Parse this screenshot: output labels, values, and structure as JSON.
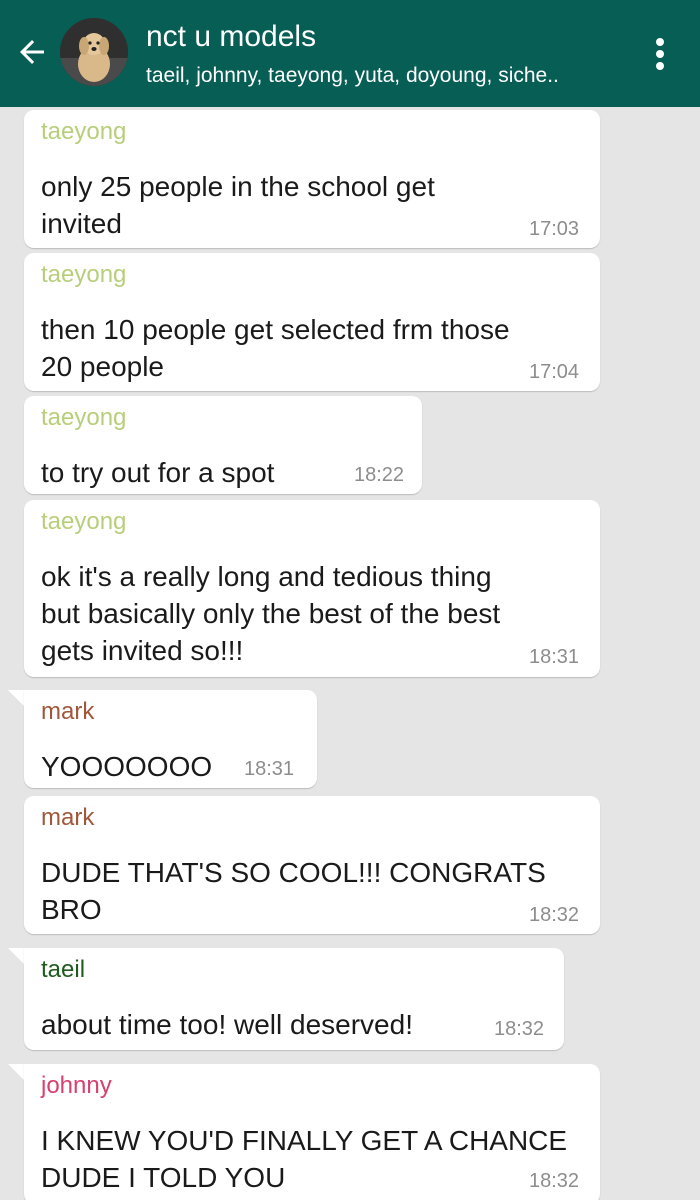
{
  "header": {
    "title": "nct u models",
    "subtitle": "taeil, johnny, taeyong, yuta, doyoung, siche..",
    "bg_color": "#075e54",
    "back_icon": "arrow-left-icon",
    "menu_icon": "more-vert-icon"
  },
  "colors": {
    "taeyong": "#b7cf7a",
    "mark": "#a0573a",
    "taeil": "#1f5a1f",
    "johnny": "#d8406e"
  },
  "messages": [
    {
      "sender": "taeyong",
      "line1": "only 25 people in the school get",
      "line2": "invited",
      "time": "17:03"
    },
    {
      "sender": "taeyong",
      "line1": "then 10 people get selected frm those",
      "line2": "20 people",
      "time": "17:04"
    },
    {
      "sender": "taeyong",
      "line1": "to try out for a spot",
      "time": "18:22"
    },
    {
      "sender": "taeyong",
      "line1": "ok it's a really long and tedious thing",
      "line2": "but basically only the best of the best",
      "line3": "gets invited so!!!",
      "time": "18:31"
    },
    {
      "sender": "mark",
      "line1": "YOOOOOOO",
      "time": "18:31"
    },
    {
      "sender": "mark",
      "line1": "DUDE THAT'S SO COOL!!! CONGRATS",
      "line2": "BRO",
      "time": "18:32"
    },
    {
      "sender": "taeil",
      "line1": "about time too! well deserved!",
      "time": "18:32"
    },
    {
      "sender": "johnny",
      "line1": "I KNEW YOU'D FINALLY GET A CHANCE",
      "line2": "DUDE I TOLD YOU",
      "time": "18:32"
    }
  ]
}
